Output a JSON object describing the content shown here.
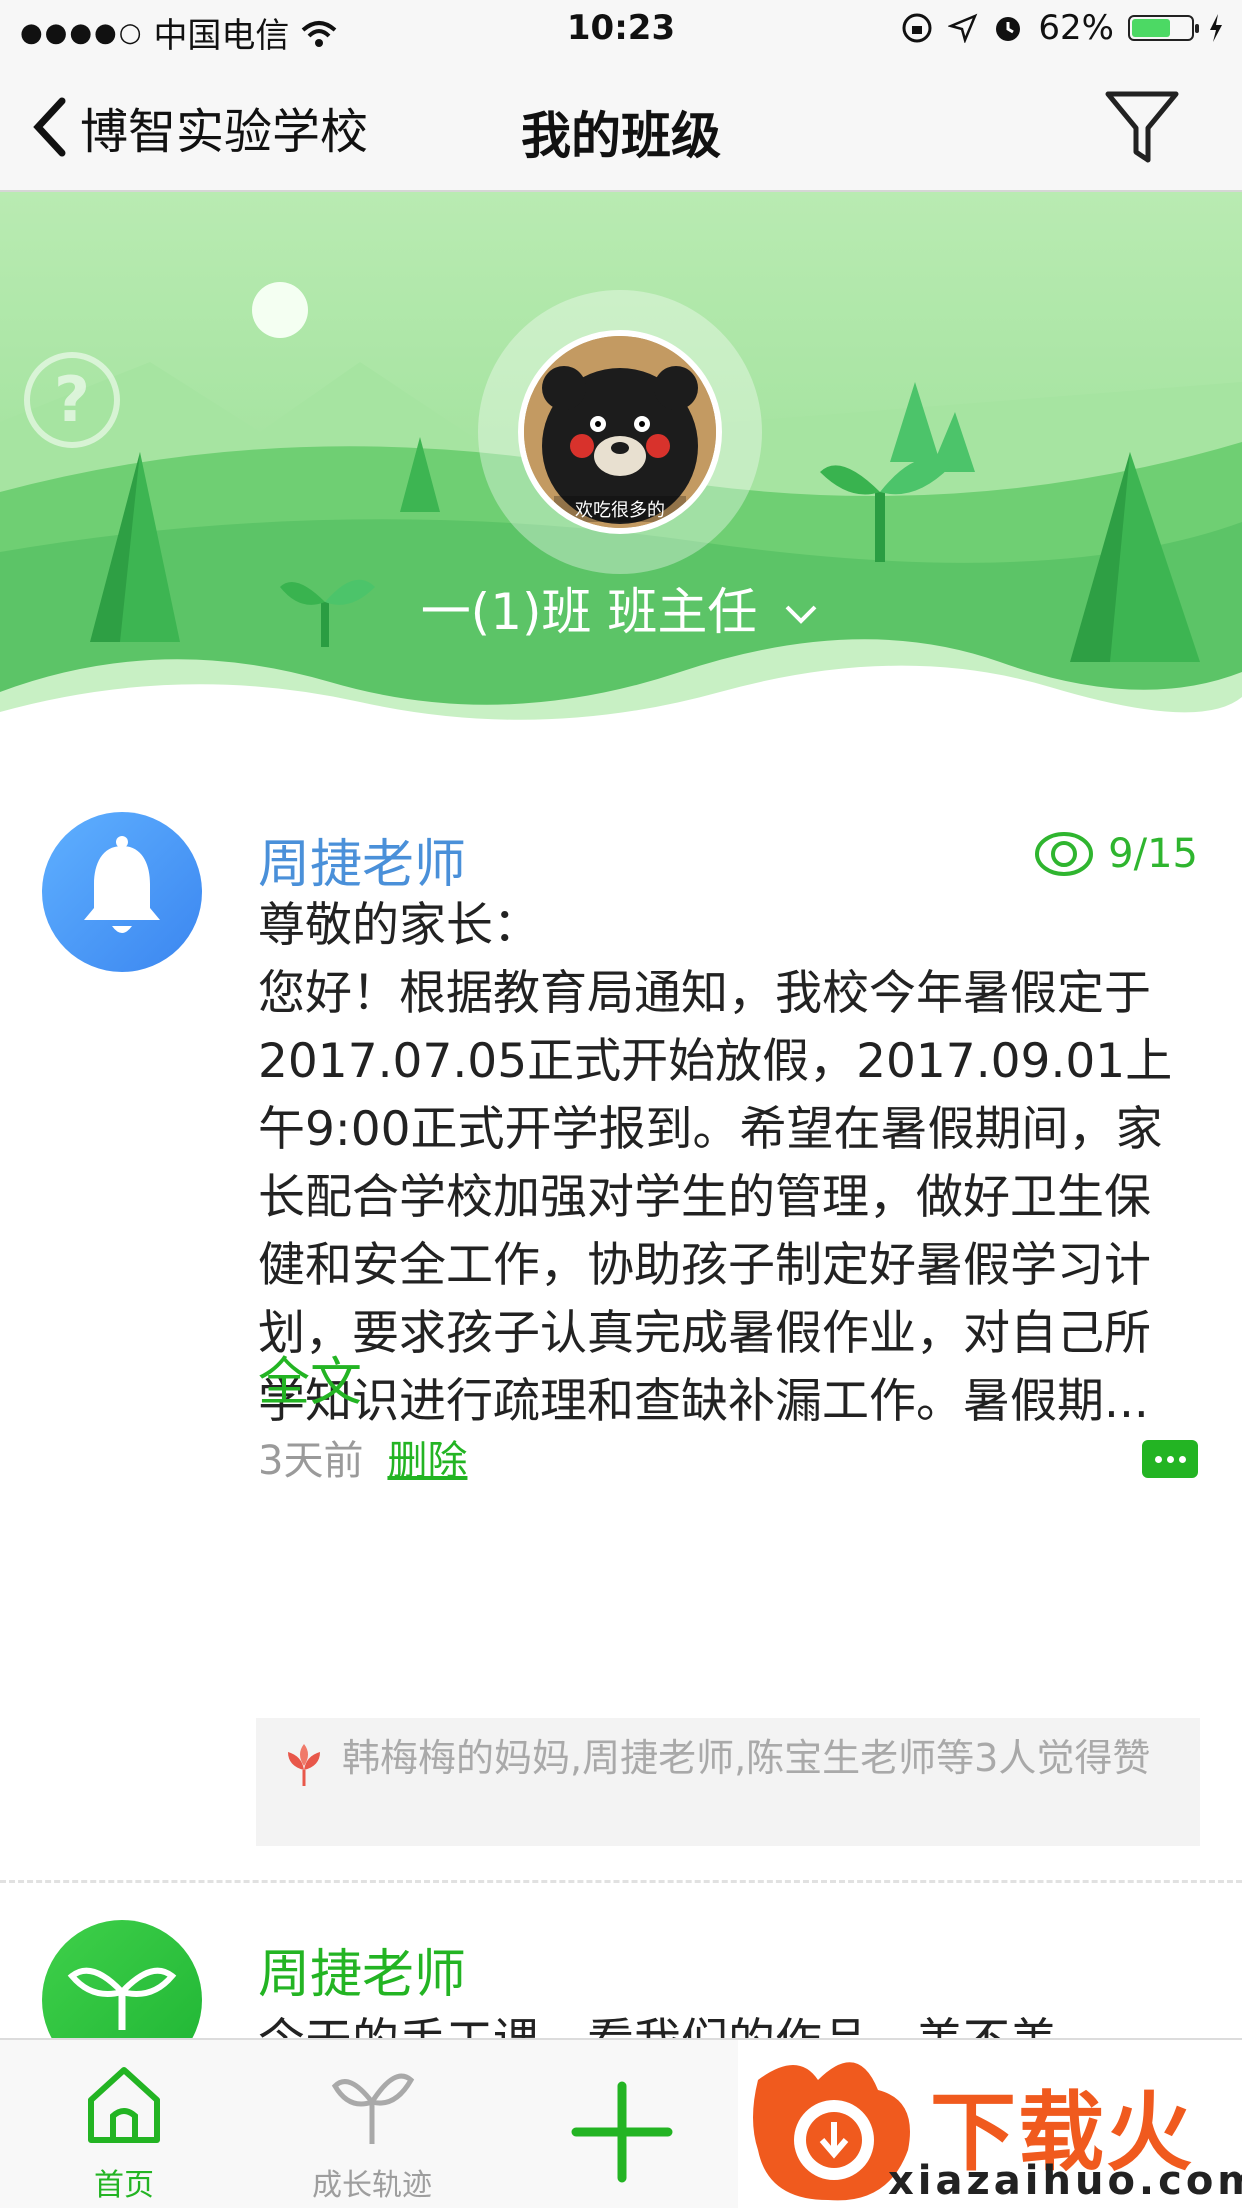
{
  "status_bar": {
    "carrier": "中国电信",
    "time": "10:23",
    "battery": "62%"
  },
  "nav": {
    "back_label": "博智实验学校",
    "title": "我的班级"
  },
  "banner": {
    "class_label": "一(1)班 班主任",
    "help_label": "?",
    "avatar_caption": "欢吃很多的"
  },
  "posts": [
    {
      "author": "周捷老师",
      "views": "9/15",
      "text": "尊敬的家长：\n您好！根据教育局通知，我校今年暑假定于2017.07.05正式开始放假，2017.09.01上午9:00正式开学报到。希望在暑假期间，家长配合学校加强对学生的管理，做好卫生保健和安全工作，协助孩子制定好暑假学习计划，要求孩子认真完成暑假作业，对自己所学知识进行疏理和查缺补漏工作。暑假期...",
      "fulltext_label": "全文",
      "time": "3天前",
      "delete_label": "删除",
      "likes": "韩梅梅的妈妈,周捷老师,陈宝生老师等3人觉得赞"
    },
    {
      "author": "周捷老师",
      "text": "今天的手工课，看我们的作品，美不美"
    }
  ],
  "tab_bar": {
    "home": "首页",
    "growth": "成长轨迹",
    "ad_brand": "下载火",
    "ad_url": "xiazaihuo.com"
  },
  "colors": {
    "green": "#23b423",
    "blue_author": "#4a90d9",
    "banner_green": "#8fdb8c"
  }
}
